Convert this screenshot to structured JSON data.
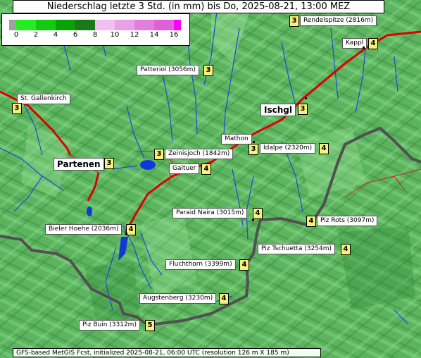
{
  "title": "Niederschlag letzte 3 Std. (in mm) bis Do, 2025-08-21, 13:00 MEZ",
  "legend": {
    "ticks": [
      "0",
      "2",
      "4",
      "6",
      "8",
      "10",
      "12",
      "14",
      "16"
    ],
    "colors": [
      "#a0a0a0",
      "#00ff00",
      "#00cc00",
      "#00a000",
      "#1a7a1a",
      "#f0b0f0",
      "#e890e0",
      "#e060d8",
      "#ff00ff"
    ]
  },
  "places": [
    {
      "name": "Rendelspitze (2816m)",
      "value": "3"
    },
    {
      "name": "Kappl",
      "value": "4"
    },
    {
      "name": "Patteriol (3056m)",
      "value": "3"
    },
    {
      "name": "St. Gallenkirch",
      "value": "3"
    },
    {
      "name": "Ischgl",
      "value": "3"
    },
    {
      "name": "Mathon",
      "value": "3"
    },
    {
      "name": "Idalpe (2320m)",
      "value": "4"
    },
    {
      "name": "Zeinisjoch (1842m)",
      "value": "3"
    },
    {
      "name": "Partenen",
      "value": "3"
    },
    {
      "name": "Galtuer",
      "value": "4"
    },
    {
      "name": "Paraid Naira (3015m)",
      "value": "4"
    },
    {
      "name": "Piz Rots (3097m)",
      "value": "4"
    },
    {
      "name": "Bieler Hoehe (2036m)",
      "value": "4"
    },
    {
      "name": "Piz Tschuetta (3254m)",
      "value": "4"
    },
    {
      "name": "Fluchthorn (3399m)",
      "value": "4"
    },
    {
      "name": "Augstenberg (3230m)",
      "value": "4"
    },
    {
      "name": "Piz Buin (3312m)",
      "value": "5"
    }
  ],
  "footer": "GFS-based MetGIS Fcst, initialized 2025-08-21, 06:00 UTC  (resolution 126 m X 185 m)"
}
